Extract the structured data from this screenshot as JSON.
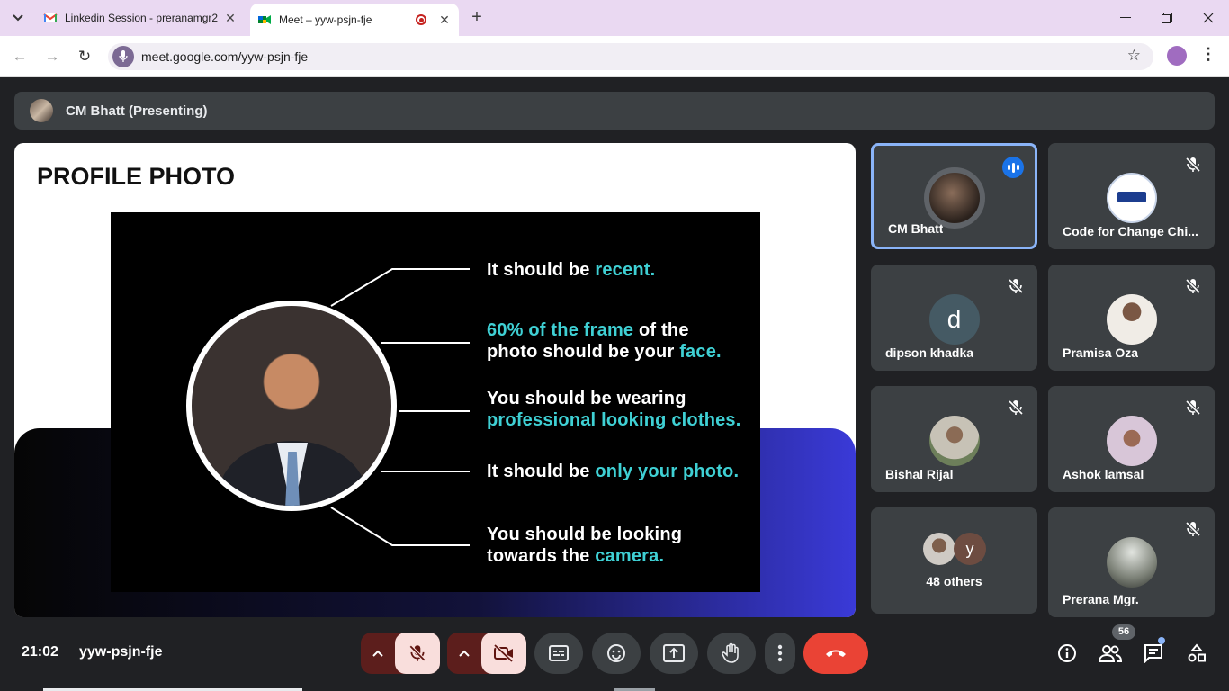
{
  "browser": {
    "tabs": [
      {
        "title": "Linkedin Session - preranamgr2",
        "icon": "gmail-icon"
      },
      {
        "title": "Meet – yyw-psjn-fje",
        "icon": "meet-icon",
        "recording": true
      }
    ],
    "url": "meet.google.com/yyw-psjn-fje"
  },
  "meet": {
    "presenter_label": "CM Bhatt (Presenting)",
    "slide": {
      "title": "PROFILE PHOTO",
      "points": [
        {
          "pre": "It should be ",
          "hl": "recent.",
          "post": ""
        },
        {
          "pre": "",
          "hl": "60% of the frame",
          "post": " of the",
          "line2_pre": "photo should be your ",
          "line2_hl": "face."
        },
        {
          "pre": "You should be wearing",
          "hl": "",
          "post": "",
          "line2_pre": "",
          "line2_hl": "professional looking clothes."
        },
        {
          "pre": "It should be ",
          "hl": "only your photo.",
          "post": ""
        },
        {
          "pre": "You should be looking",
          "hl": "",
          "post": "",
          "line2_pre": "towards the ",
          "line2_hl": "camera."
        }
      ],
      "accent_color": "#3fd0d4"
    },
    "participants": [
      {
        "name": "CM Bhatt",
        "speaking": true,
        "muted": false
      },
      {
        "name": "Code for Change Chi...",
        "muted": true
      },
      {
        "name": "dipson khadka",
        "initial": "d",
        "muted": true
      },
      {
        "name": "Pramisa Oza",
        "muted": true
      },
      {
        "name": "Bishal Rijal",
        "muted": true
      },
      {
        "name": "Ashok lamsal",
        "muted": true
      },
      {
        "name": "48 others",
        "initial": "y"
      },
      {
        "name": "Prerana Mgr.",
        "muted": true
      }
    ],
    "time": "21:02",
    "code": "yyw-psjn-fje",
    "participant_count": "56",
    "colors": {
      "end_call": "#ea4335",
      "speaking": "#1a73e8",
      "highlight_border": "#8ab4f8"
    }
  }
}
